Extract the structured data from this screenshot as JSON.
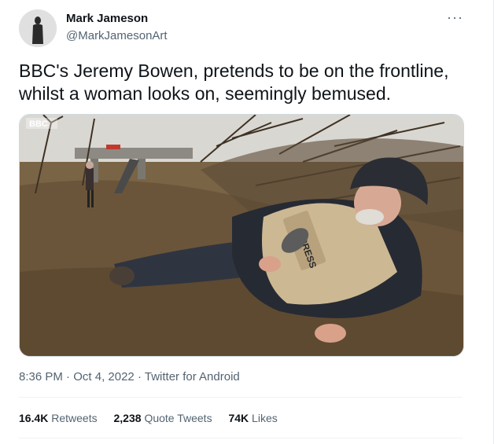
{
  "user": {
    "display_name": "Mark Jameson",
    "handle": "@MarkJamesonArt"
  },
  "more_icon": "more-horizontal-icon",
  "tweet": {
    "text": "BBC's Jeremy Bowen, pretends to be on the frontline, whilst a woman looks on, seemingly bemused."
  },
  "media": {
    "watermark": "BBC",
    "vest_label": "PRESS"
  },
  "meta": {
    "time": "8:36 PM",
    "sep1": "·",
    "date": "Oct 4, 2022",
    "sep2": "·",
    "client": "Twitter for Android"
  },
  "stats": {
    "retweets_count": "16.4K",
    "retweets_label": "Retweets",
    "quotes_count": "2,238",
    "quotes_label": "Quote Tweets",
    "likes_count": "74K",
    "likes_label": "Likes"
  },
  "colors": {
    "text_primary": "#0f1419",
    "text_secondary": "#536471",
    "border": "#cfd9de"
  }
}
